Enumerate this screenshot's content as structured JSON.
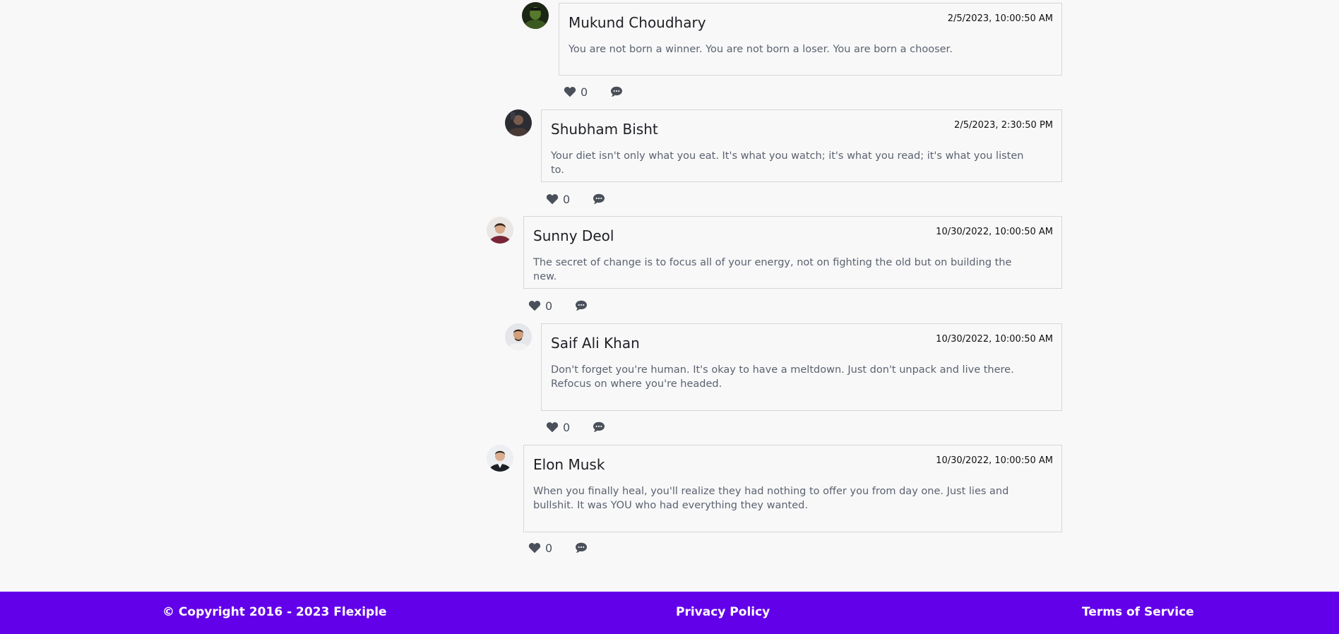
{
  "comments": [
    {
      "author": "Mukund Choudhary",
      "timestamp": "2/5/2023, 10:00:50 AM",
      "text": "You are not born a winner. You are not born a loser. You are born a chooser.",
      "likes": "0",
      "avatar": "hulk-avatar"
    },
    {
      "author": "Shubham Bisht",
      "timestamp": "2/5/2023, 2:30:50 PM",
      "text": "Your diet isn't only what you eat. It's what you watch; it's what you read; it's what you listen to.",
      "likes": "0",
      "avatar": "dark-portrait-avatar"
    },
    {
      "author": "Sunny Deol",
      "timestamp": "10/30/2022, 10:00:50 AM",
      "text": "The secret of change is to focus all of your energy, not on fighting the old but on building the new.",
      "likes": "0",
      "avatar": "woman-portrait-avatar"
    },
    {
      "author": "Saif Ali Khan",
      "timestamp": "10/30/2022, 10:00:50 AM",
      "text": "Don't forget you're human. It's okay to have a meltdown. Just don't unpack and live there. Refocus on where you're headed.",
      "likes": "0",
      "avatar": "man-portrait-avatar"
    },
    {
      "author": "Elon Musk",
      "timestamp": "10/30/2022, 10:00:50 AM",
      "text": "When you finally heal, you'll realize they had nothing to offer you from day one. Just lies and bullshit. It was YOU who had everything they wanted.",
      "likes": "0",
      "avatar": "suit-portrait-avatar"
    }
  ],
  "icons": {
    "like": "heart-icon",
    "reply": "comment-bubble-icon"
  },
  "colors": {
    "footer_bg": "#6200ea",
    "icon": "#4a505a"
  },
  "footer": {
    "copyright": "© Copyright 2016 - 2023 Flexiple",
    "privacy": "Privacy Policy",
    "terms": "Terms of Service"
  }
}
